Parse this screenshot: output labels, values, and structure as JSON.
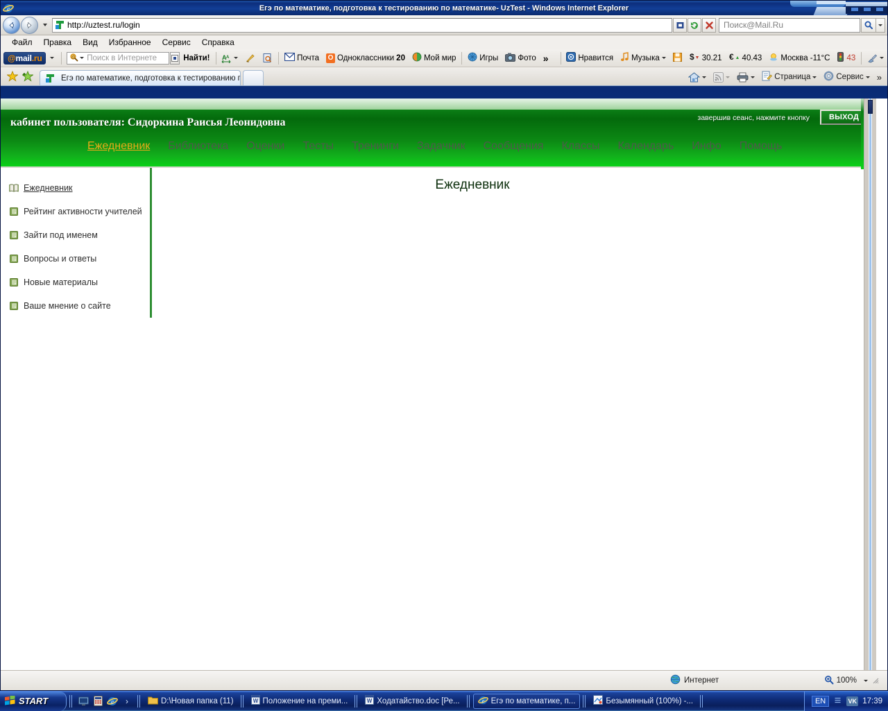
{
  "window": {
    "title": "Егэ по математике, подготовка к тестированию по математике- UzTest - Windows Internet Explorer"
  },
  "address_bar": {
    "url": "http://uztest.ru/login",
    "search_placeholder": "Поиск@Mail.Ru",
    "icons": {
      "back": "back-arrow-icon",
      "forward": "forward-arrow-icon",
      "history_dropdown": "chevron-down-icon",
      "compat_view": "compatibility-view-icon",
      "refresh": "refresh-icon",
      "stop": "stop-icon",
      "search_go": "magnifier-icon",
      "search_dropdown": "chevron-down-icon",
      "favicon": "uztest-favicon"
    }
  },
  "menubar": {
    "items": [
      "Файл",
      "Правка",
      "Вид",
      "Избранное",
      "Сервис",
      "Справка"
    ]
  },
  "mailru_toolbar": {
    "logo": "@mail.ru",
    "search_placeholder": "Поиск в Интернете",
    "find_button": "Найти!",
    "items": [
      {
        "label": "Почта",
        "icon": "envelope-icon"
      },
      {
        "label": "Одноклассники",
        "icon": "odnoklassniki-icon",
        "badge": "20"
      },
      {
        "label": "Мой мир",
        "icon": "my-world-icon"
      },
      {
        "label": "Игры",
        "icon": "games-icon"
      },
      {
        "label": "Фото",
        "icon": "photo-icon"
      }
    ],
    "overflow": "»",
    "right_items": [
      {
        "label": "Нравится",
        "icon": "like-icon"
      },
      {
        "label": "Музыка",
        "icon": "music-note-icon"
      },
      {
        "label": "",
        "icon": "save-disk-icon"
      },
      {
        "label": "30.21",
        "icon": "dollar-icon"
      },
      {
        "label": "40.43",
        "icon": "euro-icon"
      },
      {
        "label": "Москва -11°C",
        "icon": "weather-icon"
      },
      {
        "label": "43",
        "icon": "traffic-light-icon"
      },
      {
        "label": "",
        "icon": "settings-brush-icon"
      }
    ]
  },
  "tabbar": {
    "favorites_icon": "star-icon",
    "add_favorites_icon": "add-star-icon",
    "tabs": [
      {
        "title": "Егэ по математике, подготовка к тестированию п...",
        "favicon": "uztest-favicon",
        "active": true
      }
    ],
    "new_tab_label": ""
  },
  "command_bar": {
    "items": [
      {
        "label": "",
        "icon": "home-icon",
        "has_caret": true
      },
      {
        "label": "",
        "icon": "rss-icon",
        "has_caret": true
      },
      {
        "label": "",
        "icon": "printer-icon",
        "has_caret": true
      },
      {
        "label": "Страница",
        "icon": "page-icon",
        "has_caret": true
      },
      {
        "label": "Сервис",
        "icon": "gear-icon",
        "has_caret": true
      }
    ],
    "overflow": "»"
  },
  "site": {
    "cabinet_title": "кабинет пользователя: Сидоркина Раисья Леонидовна",
    "logout_hint": "завершив сеанс, нажмите кнопку",
    "logout_button": "ВЫХОД",
    "nav": [
      {
        "label": "Ежедневник",
        "active": true
      },
      {
        "label": "Библиотека",
        "active": false
      },
      {
        "label": "Оценки",
        "active": false
      },
      {
        "label": "Тесты",
        "active": false
      },
      {
        "label": "Тренинги",
        "active": false
      },
      {
        "label": "Задачник",
        "active": false
      },
      {
        "label": "Сообщения",
        "active": false
      },
      {
        "label": "Классы",
        "active": false
      },
      {
        "label": "Календарь",
        "active": false
      },
      {
        "label": "Инфо",
        "active": false
      },
      {
        "label": "Помощь",
        "active": false
      }
    ],
    "sidebar": [
      {
        "label": "Ежедневник",
        "icon": "open-book-icon",
        "current": true
      },
      {
        "label": "Рейтинг активности учителей",
        "icon": "book-icon",
        "current": false
      },
      {
        "label": "Зайти под именем",
        "icon": "book-icon",
        "current": false
      },
      {
        "label": "Вопросы и ответы",
        "icon": "book-icon",
        "current": false
      },
      {
        "label": "Новые материалы",
        "icon": "book-icon",
        "current": false
      },
      {
        "label": "Ваше мнение о сайте",
        "icon": "book-icon",
        "current": false
      }
    ],
    "content_title": "Ежедневник",
    "colors": {
      "header_dark_green": "#046a0c",
      "header_bright_green": "#0ad117",
      "active_nav": "#e8ab18",
      "sidebar_divider": "#2f8f34"
    }
  },
  "statusbar": {
    "zone": "Интернет",
    "zone_icon": "globe-icon",
    "zoom": "100%",
    "zoom_icon": "magnifier-plus-icon",
    "zoom_caret": "chevron-down-icon"
  },
  "taskbar": {
    "start_label": "START",
    "quicklaunch": [
      "show-desktop-icon",
      "calculator-icon",
      "internet-explorer-icon",
      "chevron-right-icon"
    ],
    "tasks": [
      {
        "label": "D:\\Новая папка (11)",
        "icon": "folder-icon",
        "active": false
      },
      {
        "label": "Положение на преми...",
        "icon": "word-doc-icon",
        "active": false
      },
      {
        "label": "Ходатайство.doc [Ре...",
        "icon": "word-doc-icon",
        "active": false
      },
      {
        "label": "Егэ по математике, п...",
        "icon": "internet-explorer-icon",
        "active": true
      },
      {
        "label": "Безымянный (100%) -...",
        "icon": "paint-icon",
        "active": false
      }
    ],
    "tray": {
      "language": "EN",
      "menu_icon": "tray-menu-icon",
      "vk_icon": "vk-icon",
      "clock": "17:39"
    }
  }
}
